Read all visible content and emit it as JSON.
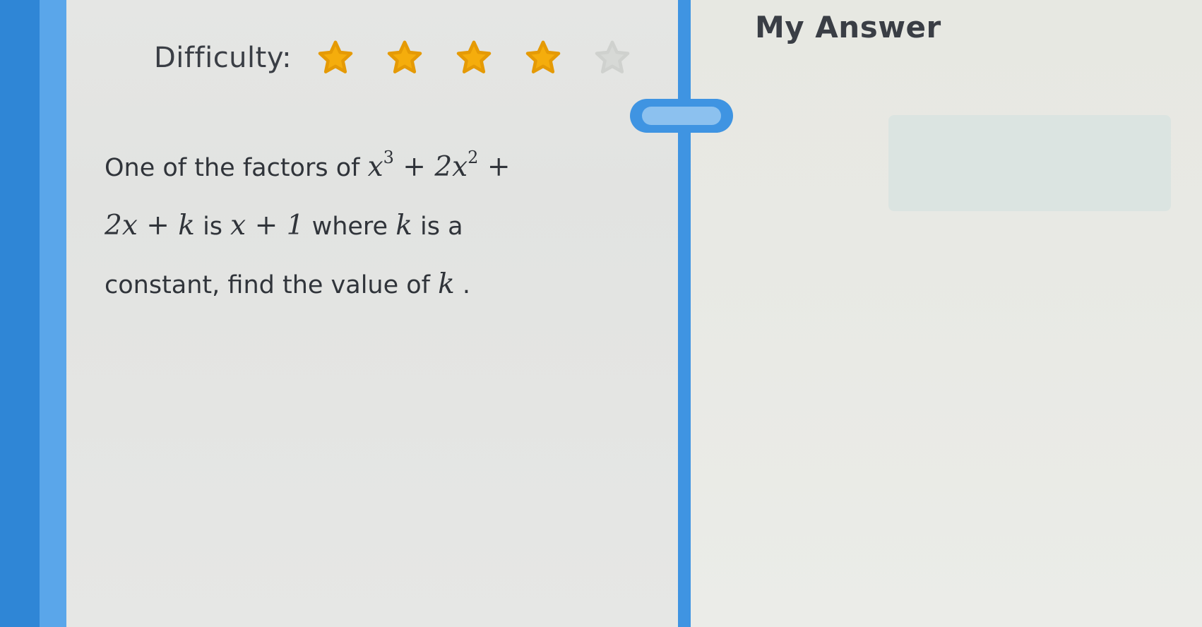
{
  "question": {
    "difficulty_label": "Difficulty:",
    "difficulty_rating": 4,
    "difficulty_max": 5,
    "intro": "One of the factors of",
    "math_poly_a": "x",
    "math_poly_a_exp": "3",
    "math_poly_b": " + 2x",
    "math_poly_b_exp": "2",
    "math_poly_c": " +",
    "math_poly_d": "2x + k",
    "is_text": "is",
    "math_factor": "x + 1",
    "where_text": "where",
    "math_k": "k",
    "is_a_text": "is a",
    "line3_text": "constant, find the value of",
    "math_k2": "k",
    "period": "."
  },
  "answer": {
    "title": "My Answer",
    "value": ""
  },
  "colors": {
    "frame_blue": "#2f86d6",
    "divider_blue": "#3f94e2",
    "star_gold": "#f5ad0c",
    "star_empty": "#d7d9d6"
  },
  "icons": {
    "star": "star-icon",
    "resize": "resize-handle-icon"
  }
}
